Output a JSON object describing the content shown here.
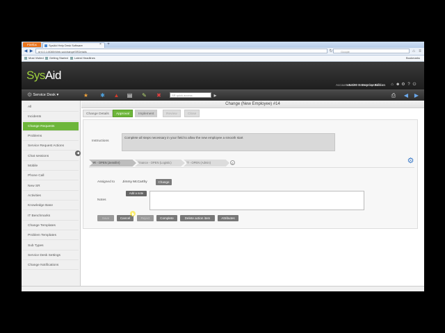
{
  "browser": {
    "menu_button": "Firefox",
    "tab_title": "SysAid Help Desk Software",
    "url": "sf 6.0.1:8080/Web.sa/changeSRDetails",
    "search_placeholder": "Google",
    "bookmarks": [
      "Most Visited",
      "Getting Started",
      "Latest Headlines"
    ],
    "bookmarks_right": "Bookmarks"
  },
  "header": {
    "logo_sys": "Sys",
    "logo_aid": "Aid",
    "edition": "v8.0.00 Enterprise Edition",
    "links": [
      "Account mode",
      "User: sysaid"
    ],
    "accent": "#6db63a"
  },
  "toolbar": {
    "service_desk": "Service Desk",
    "search_placeholder": "SR quick access"
  },
  "sidebar": {
    "items": [
      {
        "label": "All"
      },
      {
        "label": "Incidents"
      },
      {
        "label": "Change Requests"
      },
      {
        "label": "Problems"
      },
      {
        "label": "Service Request Actions"
      },
      {
        "label": "Chat sessions"
      },
      {
        "label": "Mobile"
      },
      {
        "label": "Phone Call"
      },
      {
        "label": "New SR"
      },
      {
        "label": "Activities"
      },
      {
        "label": "Knowledge Base"
      },
      {
        "label": "IT Benchmarks"
      },
      {
        "label": "Change Templates"
      },
      {
        "label": "Problem Templates"
      },
      {
        "label": "Sub Types"
      },
      {
        "label": "Service Desk Settings"
      },
      {
        "label": "Change Notifications"
      }
    ],
    "active_index": 2
  },
  "main": {
    "title": "Change (New Employee) #14",
    "tabs": [
      {
        "label": "Change Details"
      },
      {
        "label": "Approval"
      },
      {
        "label": "Implement"
      },
      {
        "label": "Review"
      },
      {
        "label": "Close"
      }
    ],
    "instructions_label": "Instructions",
    "instructions_text": "Complete all steps necessary in your field to allow the new employee a smooth start",
    "phases": [
      {
        "label": "HR - OPEN (Jennifer)"
      },
      {
        "label": "Finance - OPEN (Logistic)"
      },
      {
        "label": "IT - OPEN (Admin)"
      }
    ],
    "phase_end": "©",
    "assigned_label": "Assigned to",
    "assigned_name": "Jimmy McCarthy",
    "change_button": "Change",
    "notes_label": "Notes",
    "add_note_button": "Add a note",
    "actions": [
      {
        "label": "Save",
        "disabled": true
      },
      {
        "label": "Cancel",
        "disabled": false
      },
      {
        "label": "Reject",
        "disabled": true
      },
      {
        "label": "Complete",
        "disabled": false
      },
      {
        "label": "Delete action item",
        "disabled": false
      },
      {
        "label": "Attributes",
        "disabled": false
      }
    ]
  }
}
